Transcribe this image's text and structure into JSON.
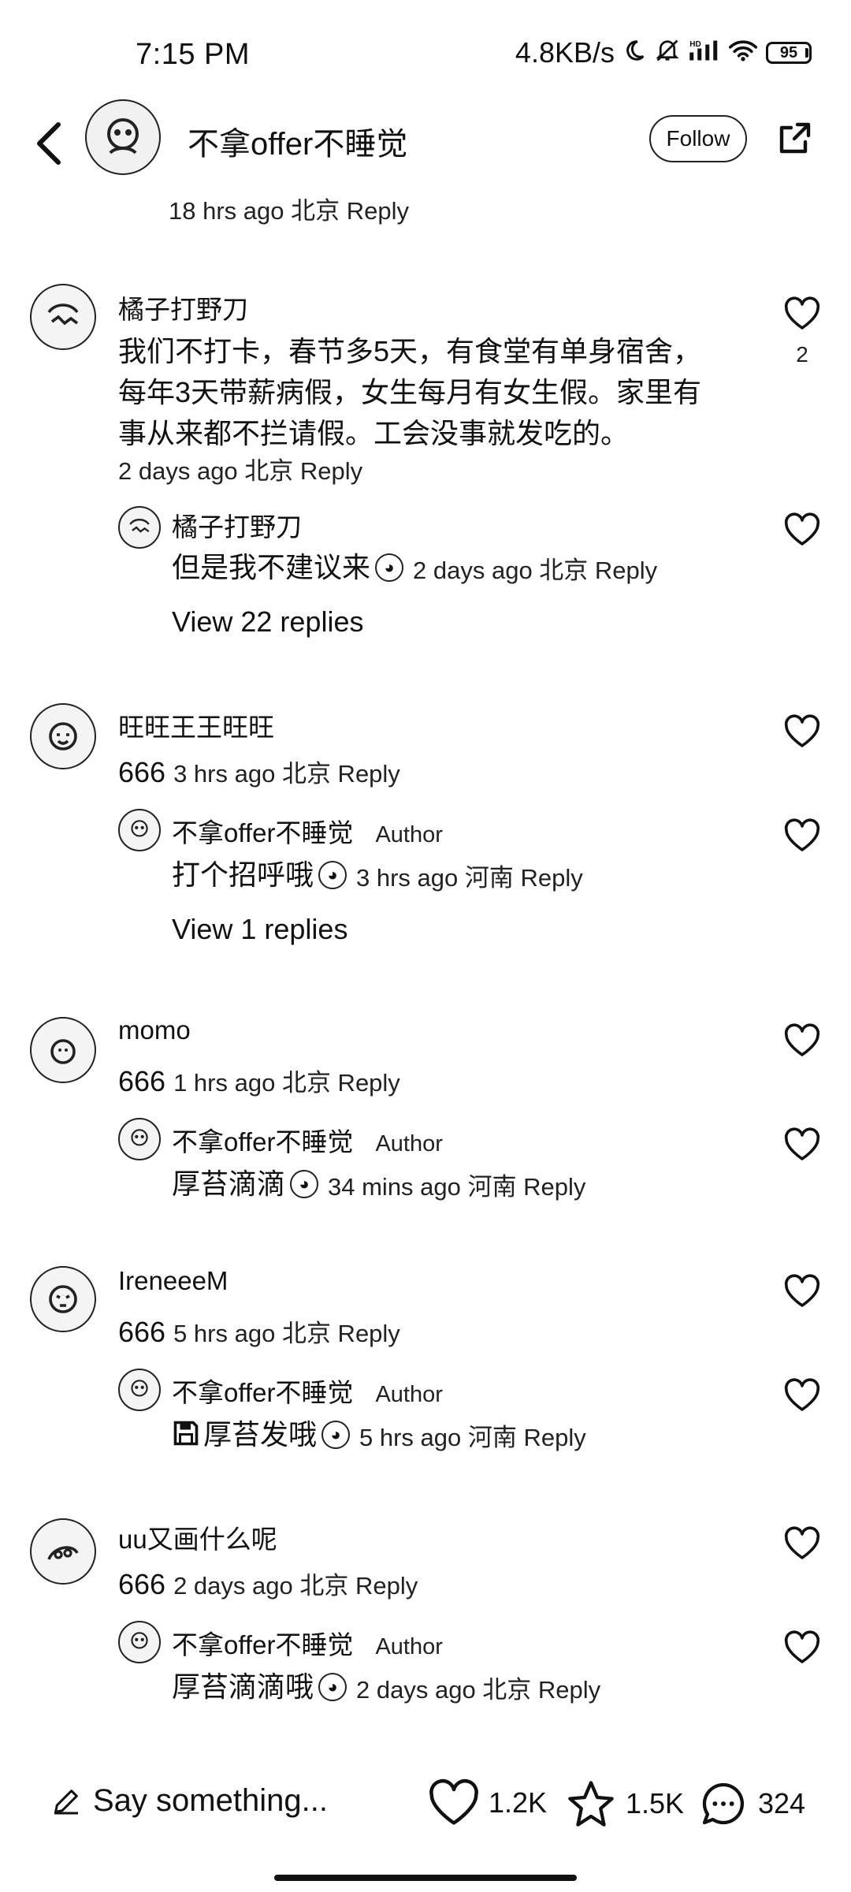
{
  "status_bar": {
    "time": "7:15 PM",
    "network_speed": "4.8KB/s",
    "battery": "95",
    "icons": [
      "moon-icon",
      "mute-icon",
      "hd-signal-icon",
      "wifi-icon",
      "battery-icon"
    ]
  },
  "header": {
    "username": "不拿offer不睡觉",
    "follow_label": "Follow"
  },
  "top_meta": "18 hrs ago 北京 Reply",
  "comments": [
    {
      "name": "橘子打野刀",
      "text_lines": [
        "我们不打卡，春节多5天，有食堂有单身宿舍，",
        "每年3天带薪病假，女生每月有女生假。家里有",
        "事从来都不拦请假。工会没事就发吃的。"
      ],
      "meta": "2 days ago 北京 Reply",
      "likes": "2",
      "reply": {
        "name": "橘子打野刀",
        "text": "但是我不建议来",
        "meta": "2 days ago 北京 Reply"
      },
      "view_replies": "View 22 replies"
    },
    {
      "name": "旺旺王王旺旺",
      "text": "666",
      "meta": "3 hrs ago 北京 Reply",
      "reply": {
        "name": "不拿offer不睡觉",
        "author_tag": "Author",
        "text": "打个招呼哦",
        "meta": "3 hrs ago 河南 Reply"
      },
      "view_replies": "View 1 replies"
    },
    {
      "name": "momo",
      "text": "666",
      "meta": "1 hrs ago 北京 Reply",
      "reply": {
        "name": "不拿offer不睡觉",
        "author_tag": "Author",
        "text": "厚苔滴滴",
        "meta": "34 mins ago 河南 Reply"
      }
    },
    {
      "name": "IreneeeM",
      "text": "666",
      "meta": "5 hrs ago 北京 Reply",
      "reply": {
        "name": "不拿offer不睡觉",
        "author_tag": "Author",
        "text": "厚苔发哦",
        "meta": "5 hrs ago 河南 Reply"
      }
    },
    {
      "name": "uu又画什么呢",
      "text": "666",
      "meta": "2 days ago 北京 Reply",
      "reply": {
        "name": "不拿offer不睡觉",
        "author_tag": "Author",
        "text": "厚苔滴滴哦",
        "meta": "2 days ago 北京 Reply"
      }
    }
  ],
  "bottom_bar": {
    "input_placeholder": "Say something...",
    "likes": "1.2K",
    "favorites": "1.5K",
    "comments": "324"
  }
}
